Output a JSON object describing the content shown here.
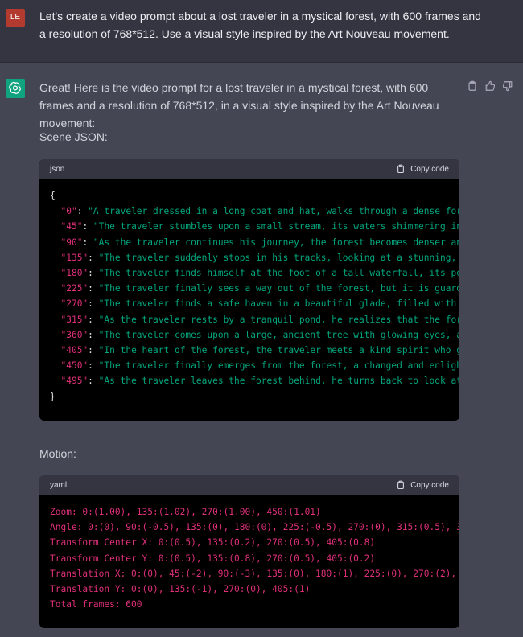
{
  "user": {
    "avatar": "LE",
    "text": "Let's create a video prompt about a lost traveler in a mystical forest, with 600 frames and a resolution of 768*512. Use a visual style inspired by the Art Nouveau movement."
  },
  "assistant": {
    "intro": "Great! Here is the video prompt for a lost traveler in a mystical forest, with 600 frames and a resolution of 768*512, in a visual style inspired by the Art Nouveau movement:",
    "scene_label": "Scene JSON:",
    "motion_label": "Motion:"
  },
  "json_block": {
    "lang": "json",
    "copy_label": "Copy code",
    "open": "{",
    "close": "}",
    "entries": [
      {
        "key": "\"0\"",
        "value": "\"A traveler dressed in a long coat and hat, walks through a dense for"
      },
      {
        "key": "\"45\"",
        "value": "\"The traveler stumbles upon a small stream, its waters shimmering in"
      },
      {
        "key": "\"90\"",
        "value": "\"As the traveler continues his journey, the forest becomes denser an"
      },
      {
        "key": "\"135\"",
        "value": "\"The traveler suddenly stops in his tracks, looking at a stunning,"
      },
      {
        "key": "\"180\"",
        "value": "\"The traveler finds himself at the foot of a tall waterfall, its po"
      },
      {
        "key": "\"225\"",
        "value": "\"The traveler finally sees a way out of the forest, but it is guard"
      },
      {
        "key": "\"270\"",
        "value": "\"The traveler finds a safe haven in a beautiful glade, filled with"
      },
      {
        "key": "\"315\"",
        "value": "\"As the traveler rests by a tranquil pond, he realizes that the for"
      },
      {
        "key": "\"360\"",
        "value": "\"The traveler comes upon a large, ancient tree with glowing eyes, a"
      },
      {
        "key": "\"405\"",
        "value": "\"In the heart of the forest, the traveler meets a kind spirit who g"
      },
      {
        "key": "\"450\"",
        "value": "\"The traveler finally emerges from the forest, a changed and enligh"
      },
      {
        "key": "\"495\"",
        "value": "\"As the traveler leaves the forest behind, he turns back to look at"
      }
    ]
  },
  "yaml_block": {
    "lang": "yaml",
    "copy_label": "Copy code",
    "lines": [
      "Zoom: 0:(1.00), 135:(1.02), 270:(1.00), 450:(1.01)",
      "Angle: 0:(0), 90:(-0.5), 135:(0), 180:(0), 225:(-0.5), 270:(0), 315:(0.5), 3",
      "Transform Center X: 0:(0.5), 135:(0.2), 270:(0.5), 405:(0.8)",
      "Transform Center Y: 0:(0.5), 135:(0.8), 270:(0.5), 405:(0.2)",
      "Translation X: 0:(0), 45:(-2), 90:(-3), 135:(0), 180:(1), 225:(0), 270:(2),",
      "Translation Y: 0:(0), 135:(-1), 270:(0), 405:(1)",
      "Total frames: 600"
    ]
  },
  "colors": {
    "user_bg": "#343541",
    "assistant_bg": "#444654",
    "code_bg": "#000000",
    "key_color": "#df3079",
    "string_color": "#00a67d",
    "bot_avatar": "#10a37f",
    "user_avatar": "#b33a2e"
  },
  "icons": [
    "openai-logo-icon",
    "clipboard-icon",
    "thumbs-up-icon",
    "thumbs-down-icon"
  ]
}
